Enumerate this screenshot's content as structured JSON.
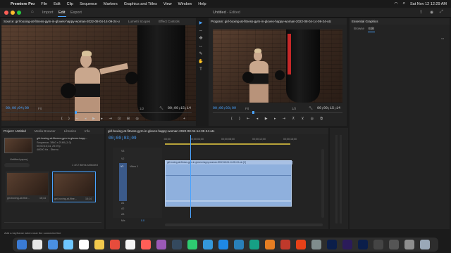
{
  "menubar": {
    "apple": "",
    "items": [
      "Premiere Pro",
      "File",
      "Edit",
      "Clip",
      "Sequence",
      "Markers",
      "Graphics and Titles",
      "View",
      "Window",
      "Help"
    ],
    "clock": "Sat Nov 12  12:29 AM"
  },
  "topbar": {
    "home": "⌂",
    "tabs": [
      "Import",
      "Edit",
      "Export"
    ],
    "active_tab": "Edit",
    "title": "Untitled",
    "title_status": "- Edited"
  },
  "source": {
    "tabs": [
      "Source: girl-boxing-at-fitness-gym-in-gloves-happy-woman-2022-08-04-14-09-24-utc",
      "Lumetri Scopes",
      "Effect Controls"
    ],
    "timecode_left": "00;00;04;00",
    "fit": "Fit",
    "timecode_right": "00;00;15;14",
    "ratio": "1/2"
  },
  "program": {
    "tab": "Program: girl-boxing-at-fitness-gym-in-gloves-happy-woman-2022-08-04-14-09-24-utc",
    "timecode_left": "00;00;03;09",
    "fit": "Fit",
    "timecode_right": "00;00;15;14",
    "ratio": "1/2"
  },
  "essential_graphics": {
    "title": "Essential Graphics",
    "tabs": [
      "Browse",
      "Edit"
    ],
    "active_tab": "Edit"
  },
  "project": {
    "tabs": [
      "Project: Untitled",
      "Media Browser",
      "Libraries",
      "Info"
    ],
    "clip_name": "girl-boxing-at-fitness-gym-in-gloves-happ...",
    "clip_meta1": "Sequence, 3840 x 2160 (1.0)",
    "clip_meta2": "00;00;15;14, 29.97p",
    "clip_meta3": "48000 Hz - Stereo",
    "project_file": "Untitled.prproj",
    "selection": "1 of 2 items selected",
    "items": [
      {
        "name": "girl-boxing-at-fitne...",
        "duration": "15;14"
      },
      {
        "name": "girl-boxing-at-fitne...",
        "duration": "15;14"
      }
    ]
  },
  "timeline": {
    "tab": "girl-boxing-at-fitness-gym-in-gloves-happy-woman-2022-08-04-14-09-24-utc",
    "timecode": "00;00;03;09",
    "ruler": [
      ":00;00",
      "00;00;04;00",
      "00;00;08;00",
      "00;00;12;00",
      "00;00;16;00"
    ],
    "tracks_video": [
      "V3",
      "V2",
      "V1"
    ],
    "tracks_audio": [
      "A1",
      "A2",
      "A3"
    ],
    "video_label": "Video 1",
    "clip_label": "girl-boxing-at-fitness-gym-in-gloves-happy-woman-2022-08-04-14-09-24-utc [V]",
    "mix": "Mix",
    "mix_value": "0.0"
  },
  "status": {
    "text": "Add a keyframe when near the connector line"
  },
  "tools": [
    "▶",
    "⇔",
    "✥",
    "↔",
    "✎",
    "✋",
    "T"
  ],
  "dock": {
    "app_colors": [
      "#3a7bd5",
      "#e8e8e8",
      "#4a90e2",
      "#6ec6ff",
      "#ffffff",
      "#f2c94c",
      "#e74c3c",
      "#f5f5f5",
      "#ff5e57",
      "#9b59b6",
      "#34495e",
      "#2ecc71",
      "#3498db",
      "#1e88e5",
      "#2980b9",
      "#16a085",
      "#e67e22",
      "#c0392b",
      "#e84118",
      "#7f8c8d",
      "#0b1e4a",
      "#2b1b5a",
      "#0b1e4a",
      "#444444",
      "#555555",
      "#8e8e8e",
      "#9aa8b8"
    ]
  }
}
